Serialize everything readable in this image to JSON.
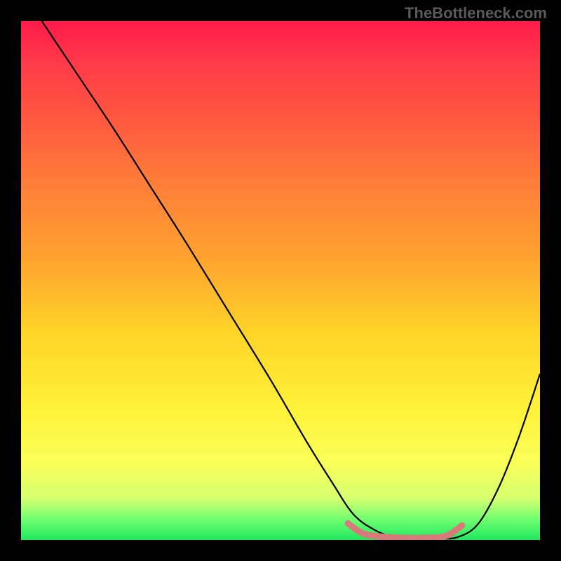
{
  "watermark": "TheBottleneck.com",
  "chart_data": {
    "type": "line",
    "title": "",
    "xlabel": "",
    "ylabel": "",
    "xlim": [
      0,
      100
    ],
    "ylim": [
      0,
      100
    ],
    "series": [
      {
        "name": "bottleneck-curve",
        "color": "#000000",
        "x": [
          4,
          8,
          12,
          18,
          25,
          32,
          40,
          48,
          55,
          60,
          64,
          68,
          72,
          76,
          80,
          84,
          88,
          92,
          96,
          100
        ],
        "y": [
          100,
          94,
          88,
          79,
          68,
          57,
          44,
          31,
          19,
          11,
          5,
          2,
          0.5,
          0.3,
          0.3,
          0.5,
          3,
          10,
          20,
          32
        ]
      },
      {
        "name": "marker-band",
        "color": "#d87a7a",
        "x": [
          63,
          66,
          70,
          74,
          78,
          82,
          85
        ],
        "y": [
          3.2,
          1.2,
          0.6,
          0.4,
          0.4,
          0.8,
          2.8
        ]
      }
    ],
    "gradient_stops": [
      {
        "pos": 0,
        "color": "#ff1a4a"
      },
      {
        "pos": 8,
        "color": "#ff3a4a"
      },
      {
        "pos": 18,
        "color": "#ff5540"
      },
      {
        "pos": 30,
        "color": "#ff7a3a"
      },
      {
        "pos": 45,
        "color": "#ffa030"
      },
      {
        "pos": 60,
        "color": "#ffd428"
      },
      {
        "pos": 75,
        "color": "#fff23a"
      },
      {
        "pos": 85,
        "color": "#faff58"
      },
      {
        "pos": 92,
        "color": "#d6ff70"
      },
      {
        "pos": 96,
        "color": "#70ff70"
      },
      {
        "pos": 100,
        "color": "#20e860"
      }
    ]
  }
}
